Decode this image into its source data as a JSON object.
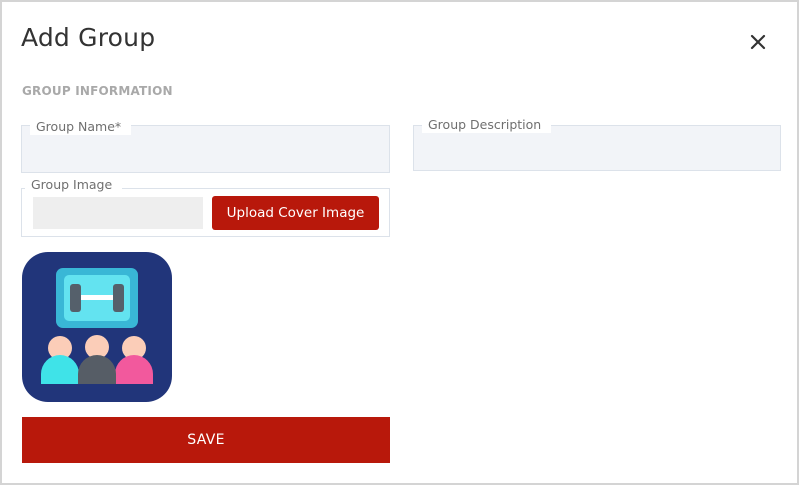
{
  "dialog": {
    "title": "Add Group",
    "close_icon": "close-icon"
  },
  "section": {
    "title": "GROUP INFORMATION"
  },
  "fields": {
    "group_name": {
      "label": "Group Name*",
      "value": ""
    },
    "group_description": {
      "label": "Group Description",
      "value": ""
    },
    "group_image": {
      "label": "Group Image",
      "file_value": ""
    }
  },
  "upload": {
    "button_label": "Upload Cover Image"
  },
  "image": {
    "icon": "group-meeting-icon"
  },
  "actions": {
    "save_label": "SAVE"
  },
  "colors": {
    "accent": "#b8180b",
    "field_bg": "#f2f4f8",
    "image_bg": "#21357a"
  }
}
